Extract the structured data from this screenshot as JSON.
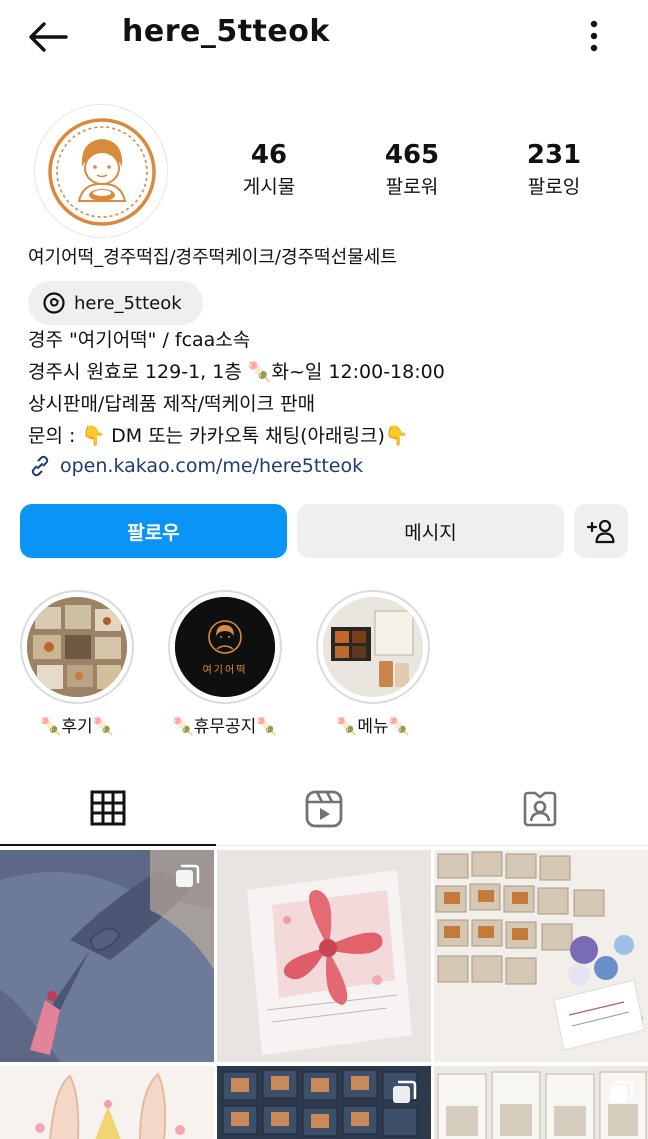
{
  "header": {
    "username": "here_5tteok",
    "back_icon": "arrow-left-icon",
    "more_icon": "more-vertical-icon"
  },
  "stats": [
    {
      "value": "46",
      "label": "게시물"
    },
    {
      "value": "465",
      "label": "팔로워"
    },
    {
      "value": "231",
      "label": "팔로잉"
    }
  ],
  "bio": {
    "name": "여기어떡_경주떡집/경주떡케이크/경주떡선물세트",
    "threads_handle": "here_5tteok",
    "lines": [
      "경주 \"여기어떡\" / fcaa소속",
      "경주시 원효로 129-1, 1층 🍡화~일 12:00-18:00",
      "상시판매/답례품 제작/떡케이크 판매",
      "문의 : 👇 DM 또는 카카오톡 채팅(아래링크)👇"
    ],
    "link": "open.kakao.com/me/here5tteok"
  },
  "actions": {
    "follow": "팔로우",
    "message": "메시지",
    "add_user_icon": "add-user-icon"
  },
  "highlights": [
    {
      "label": "🍡후기🍡"
    },
    {
      "label": "🍡휴무공지🍡",
      "logo_text": "여기어떡"
    },
    {
      "label": "🍡메뉴🍡"
    }
  ],
  "tabs": [
    {
      "name": "grid",
      "icon": "grid-icon"
    },
    {
      "name": "reels",
      "icon": "reels-icon"
    },
    {
      "name": "tagged",
      "icon": "tagged-icon"
    }
  ],
  "colors": {
    "accent": "#0a95f6",
    "link": "#213b6e",
    "brand_orange": "#d98a3c"
  }
}
